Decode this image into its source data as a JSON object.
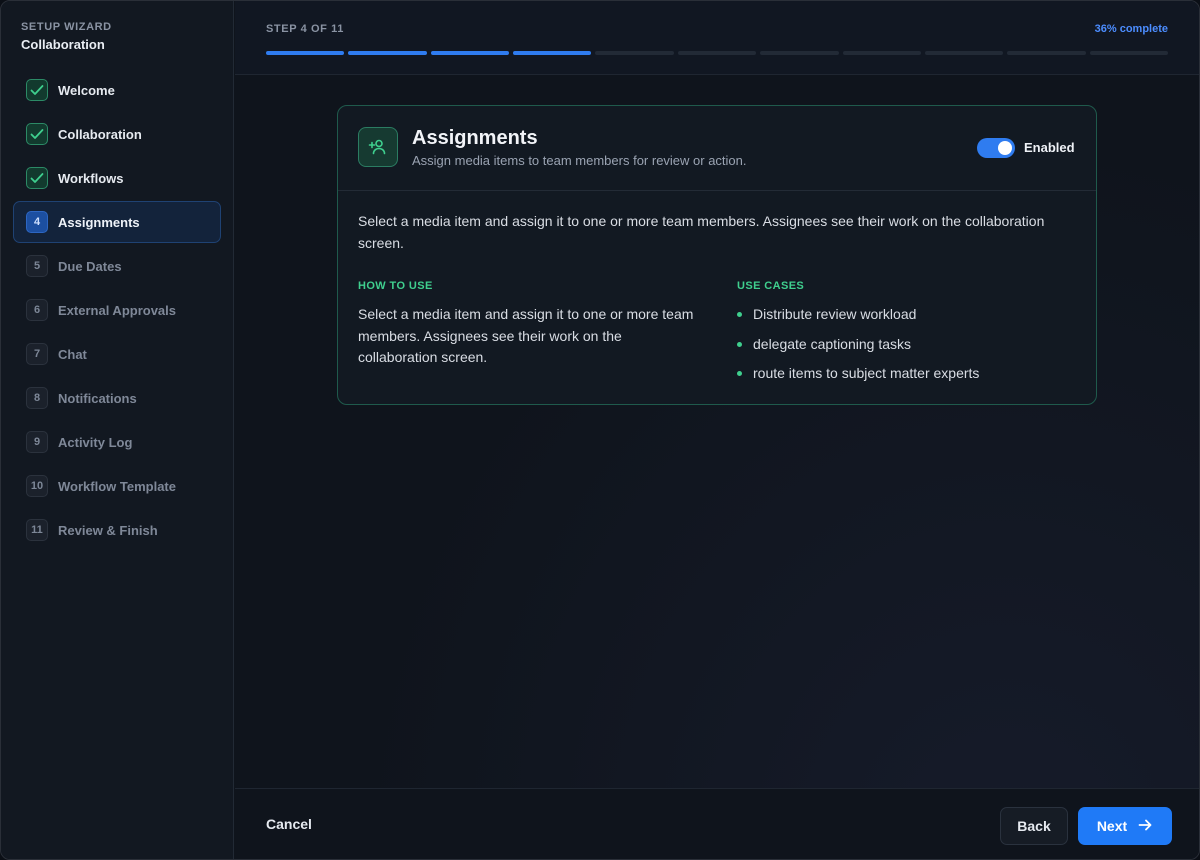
{
  "sidebar": {
    "eyebrow": "SETUP WIZARD",
    "title": "Collaboration",
    "steps": [
      {
        "num": "1",
        "label": "Welcome",
        "state": "done"
      },
      {
        "num": "2",
        "label": "Collaboration",
        "state": "done"
      },
      {
        "num": "3",
        "label": "Workflows",
        "state": "done"
      },
      {
        "num": "4",
        "label": "Assignments",
        "state": "active"
      },
      {
        "num": "5",
        "label": "Due Dates",
        "state": "todo"
      },
      {
        "num": "6",
        "label": "External Approvals",
        "state": "todo"
      },
      {
        "num": "7",
        "label": "Chat",
        "state": "todo"
      },
      {
        "num": "8",
        "label": "Notifications",
        "state": "todo"
      },
      {
        "num": "9",
        "label": "Activity Log",
        "state": "todo"
      },
      {
        "num": "10",
        "label": "Workflow Template",
        "state": "todo"
      },
      {
        "num": "11",
        "label": "Review & Finish",
        "state": "todo"
      }
    ]
  },
  "header": {
    "step_text": "STEP 4 OF 11",
    "percent_text": "36% complete",
    "progress": {
      "completed_segments": 4,
      "total_segments": 11
    }
  },
  "card": {
    "icon": "user-plus-icon",
    "title": "Assignments",
    "subtitle": "Assign media items to team members for review or action.",
    "toggle_label": "Enabled",
    "toggle_on": true,
    "description": "Select a media item and assign it to one or more team members. Assignees see their work on the collaboration screen.",
    "how_to_use_heading": "HOW TO USE",
    "how_to_use_text": "Select a media item and assign it to one or more team members. Assignees see their work on the collaboration screen.",
    "use_cases_heading": "USE CASES",
    "use_cases": [
      "Distribute review workload",
      "delegate captioning tasks",
      "route items to subject matter experts"
    ]
  },
  "footer": {
    "cancel_label": "Cancel",
    "back_label": "Back",
    "next_label": "Next"
  },
  "colors": {
    "accent": "#1f7af7",
    "success": "#3fcf8e",
    "background": "#0f141c"
  }
}
